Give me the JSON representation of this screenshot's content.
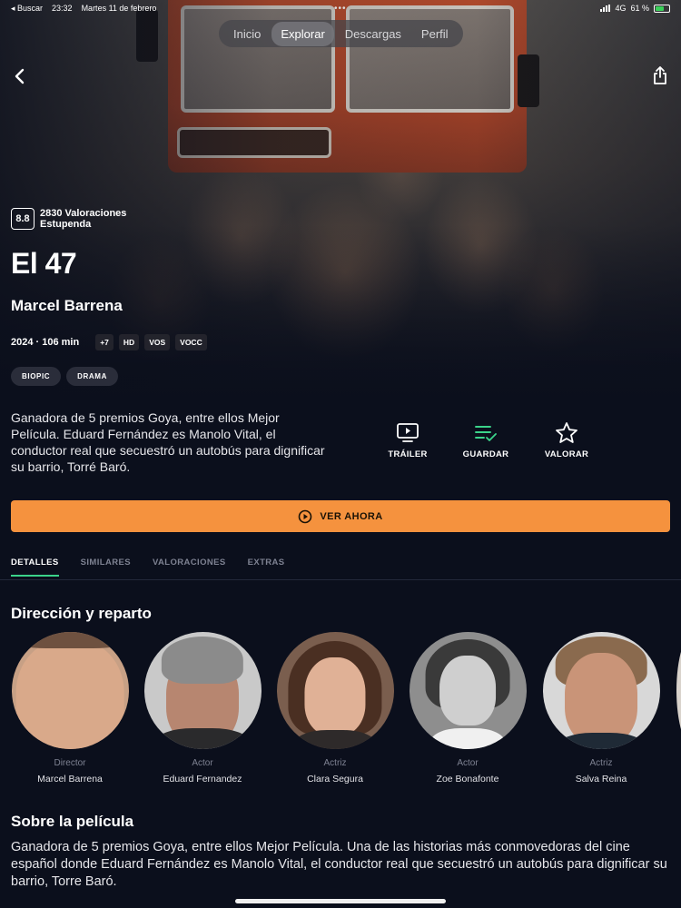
{
  "status": {
    "back_app": "◂ Buscar",
    "time": "23:32",
    "date": "Martes 11 de febrero",
    "network": "4G",
    "battery": "61 %"
  },
  "nav": {
    "tabs": [
      {
        "label": "Inicio"
      },
      {
        "label": "Explorar"
      },
      {
        "label": "Descargas"
      },
      {
        "label": "Perfil"
      }
    ],
    "active": "Explorar"
  },
  "movie": {
    "score": "8.8",
    "ratings_count": "2830 Valoraciones",
    "ratings_label": "Estupenda",
    "title": "El 47",
    "director": "Marcel Barrena",
    "year_duration": "2024 · 106 min",
    "chips": [
      "+7",
      "HD",
      "VOS",
      "VOCC"
    ],
    "genres": [
      "BIOPIC",
      "DRAMA"
    ],
    "synopsis": "Ganadora de 5 premios Goya, entre ellos Mejor Película. Eduard Fernández es Manolo Vital, el conductor real que secuestró un autobús para dignificar su barrio, Torré Baró."
  },
  "actions": {
    "trailer": "TRÁILER",
    "save": "GUARDAR",
    "rate": "VALORAR",
    "save_color": "#3bd38a"
  },
  "watch_now": "VER AHORA",
  "accent": "#f5923e",
  "detail_tabs": [
    "DETALLES",
    "SIMILARES",
    "VALORACIONES",
    "EXTRAS"
  ],
  "cast_section": {
    "title": "Dirección y reparto",
    "people": [
      {
        "role": "Director",
        "name": "Marcel Barrena"
      },
      {
        "role": "Actor",
        "name": "Eduard Fernandez"
      },
      {
        "role": "Actriz",
        "name": "Clara Segura"
      },
      {
        "role": "Actor",
        "name": "Zoe Bonafonte"
      },
      {
        "role": "Actriz",
        "name": "Salva Reina"
      }
    ]
  },
  "about": {
    "title": "Sobre la película",
    "text": "Ganadora de 5 premios Goya, entre ellos Mejor Película. Una de las historias más conmovedoras del cine español donde Eduard Fernández es Manolo Vital, el conductor real que secuestró un autobús para dignificar su barrio, Torre Baró."
  }
}
